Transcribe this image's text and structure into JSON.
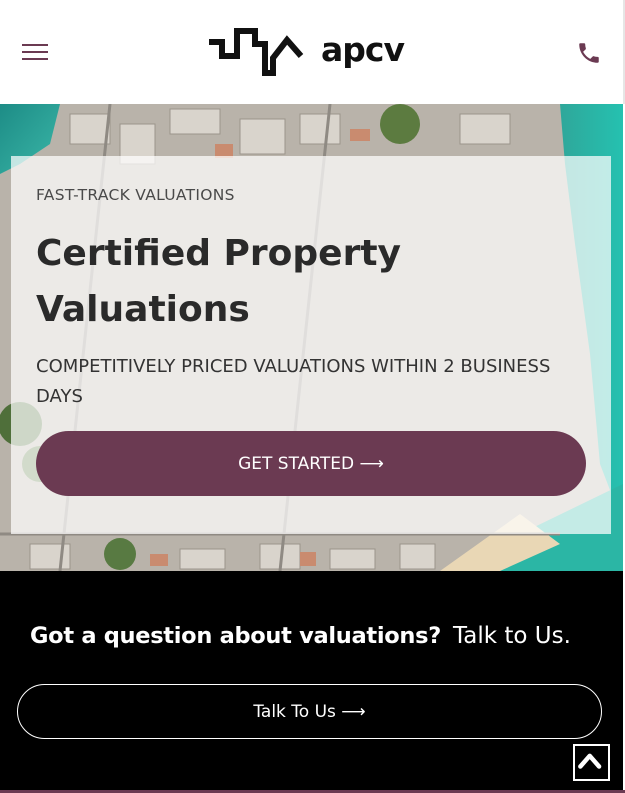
{
  "header": {
    "menu_icon": "hamburger-menu-icon",
    "logo_text": "apcv",
    "phone_icon": "phone-icon"
  },
  "hero": {
    "eyebrow": "FAST-TRACK VALUATIONS",
    "title": "Certified Property Valuations",
    "subtitle": "COMPETITIVELY PRICED VALUATIONS WITHIN 2 BUSINESS DAYS",
    "cta_label": "GET STARTED ⟶"
  },
  "contact": {
    "question": "Got a question about valuations?",
    "link_label": "Talk to Us.",
    "button_label": "Talk To Us ⟶"
  },
  "scroll_top_icon": "chevron-up-icon",
  "colors": {
    "brand": "#6b3a52",
    "dark": "#000000",
    "text": "#2a2a2a"
  }
}
